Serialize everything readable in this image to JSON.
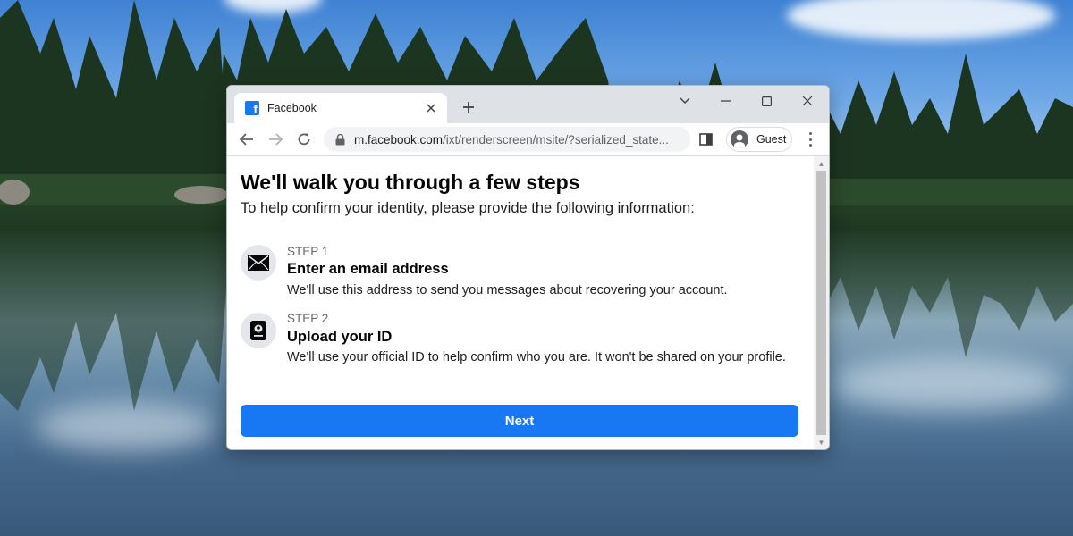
{
  "browser": {
    "tab": {
      "title": "Facebook",
      "favicon_icon": "facebook-icon",
      "close_icon": "close-icon"
    },
    "newtab_icon": "plus-icon",
    "window_controls": [
      "chevron-down-icon",
      "minimize-icon",
      "maximize-icon",
      "close-icon"
    ],
    "toolbar": {
      "back_icon": "arrow-left-icon",
      "forward_icon": "arrow-right-icon",
      "reload_icon": "reload-icon",
      "lock_icon": "lock-icon",
      "url_domain": "m.facebook.com",
      "url_rest": "/ixt/renderscreen/msite/?serialized_state...",
      "sidepanel_icon": "side-panel-icon",
      "profile_label": "Guest",
      "menu_icon": "more-vertical-icon"
    }
  },
  "page": {
    "heading": "We'll walk you through a few steps",
    "subheading": "To help confirm your identity, please provide the following information:",
    "steps": [
      {
        "label": "STEP 1",
        "title": "Enter an email address",
        "description": "We'll use this address to send you messages about recovering your account.",
        "icon": "envelope-icon"
      },
      {
        "label": "STEP 2",
        "title": "Upload your ID",
        "description": "We'll use your official ID to help confirm who you are. It won't be shared on your profile.",
        "icon": "id-card-icon"
      }
    ],
    "next_button": "Next",
    "accent_color": "#1877f2"
  }
}
